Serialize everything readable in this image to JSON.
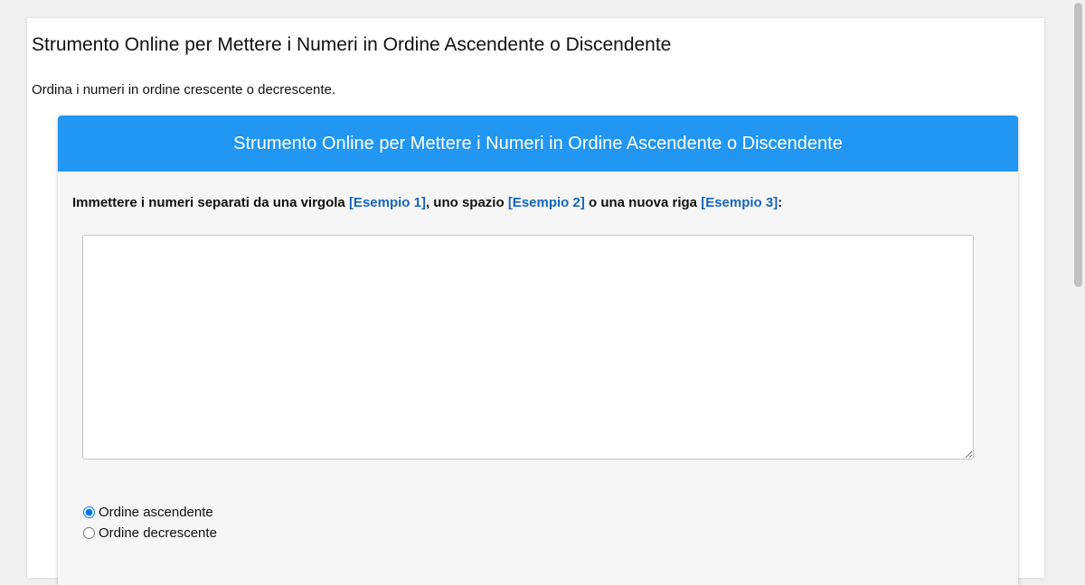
{
  "page": {
    "title": "Strumento Online per Mettere i Numeri in Ordine Ascendente o Discendente",
    "subtitle": "Ordina i numeri in ordine crescente o decrescente."
  },
  "tool": {
    "header": "Strumento Online per Mettere i Numeri in Ordine Ascendente o Discendente",
    "instructions": {
      "part1": "Immettere i numeri separati da una virgola ",
      "example1": "[Esempio 1]",
      "part2": ", uno spazio ",
      "example2": "[Esempio 2]",
      "part3": " o una nuova riga ",
      "example3": "[Esempio 3]",
      "part4": ":"
    },
    "numbers_input": {
      "value": "",
      "placeholder": ""
    },
    "options": {
      "ascending_label": "Ordine ascendente",
      "descending_label": "Ordine decrescente",
      "selected": "ascending"
    }
  },
  "colors": {
    "header_bg": "#2196f3",
    "link": "#1565c0",
    "card_bg": "#f6f6f6"
  }
}
